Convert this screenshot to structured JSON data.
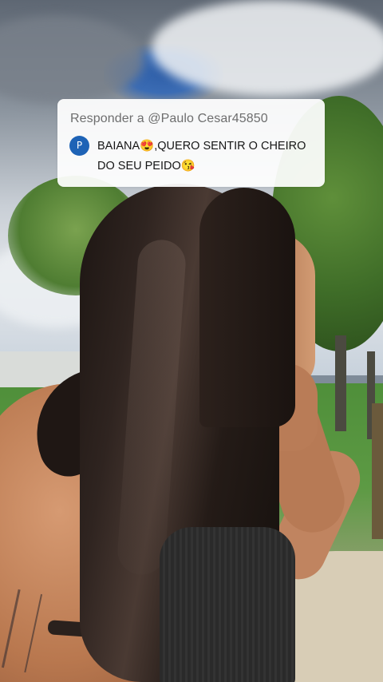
{
  "reply": {
    "header": "Responder a @Paulo Cesar45850",
    "avatar_initial": "P",
    "comment": "BAIANA😍,QUERO SENTIR O CHEIRO DO SEU PEIDO😘"
  },
  "colors": {
    "avatar_bg": "#1e63b6",
    "card_bg": "#ffffff",
    "header_text": "#6e6e6e",
    "comment_text": "#161616"
  }
}
